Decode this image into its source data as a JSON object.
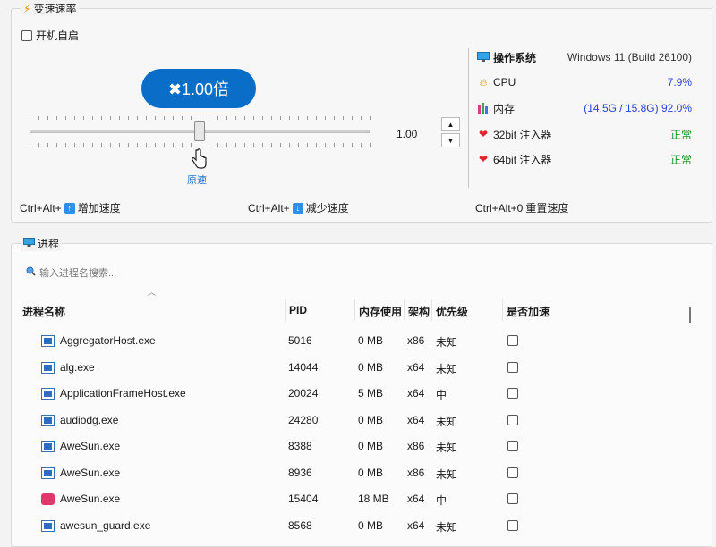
{
  "speed_group": {
    "title": "变速速率",
    "autostart_label": "开机自启",
    "multiplier_label": "✖1.00倍",
    "slider_value": 1.0,
    "speed_value": "1.00",
    "default_label": "原速",
    "spinner_up": "▲",
    "spinner_down": "▼"
  },
  "system_info": [
    {
      "icon": "monitor-icon",
      "label": "操作系统",
      "value": "Windows 11 (Build 26100)",
      "color": "gray"
    },
    {
      "icon": "flame-icon",
      "label": "CPU",
      "value": "7.9%",
      "color": "blue"
    },
    {
      "icon": "memory-icon",
      "label": "内存",
      "value": "(14.5G / 15.8G) 92.0%",
      "color": "blue"
    },
    {
      "icon": "heart-icon",
      "label": "32bit 注入器",
      "value": "正常",
      "color": "green"
    },
    {
      "icon": "heart-icon",
      "label": "64bit 注入器",
      "value": "正常",
      "color": "green"
    }
  ],
  "hotkeys": [
    {
      "prefix": "Ctrl+Alt+",
      "arrow": "↑",
      "label": "增加速度"
    },
    {
      "prefix": "Ctrl+Alt+",
      "arrow": "↓",
      "label": "减少速度"
    },
    {
      "prefix": "Ctrl+Alt+0",
      "arrow": "",
      "label": "重置速度"
    }
  ],
  "process_group": {
    "title": "进程",
    "search_placeholder": "输入进程名搜索...",
    "columns": [
      "进程名称",
      "PID",
      "内存使用",
      "架构",
      "优先级",
      "是否加速"
    ],
    "rows": [
      {
        "icon": "win",
        "name": "AggregatorHost.exe",
        "pid": "5016",
        "mem": "0 MB",
        "arch": "x86",
        "prio": "未知"
      },
      {
        "icon": "win",
        "name": "alg.exe",
        "pid": "14044",
        "mem": "0 MB",
        "arch": "x64",
        "prio": "未知"
      },
      {
        "icon": "win",
        "name": "ApplicationFrameHost.exe",
        "pid": "20024",
        "mem": "5 MB",
        "arch": "x64",
        "prio": "中"
      },
      {
        "icon": "win",
        "name": "audiodg.exe",
        "pid": "24280",
        "mem": "0 MB",
        "arch": "x64",
        "prio": "未知"
      },
      {
        "icon": "win",
        "name": "AweSun.exe",
        "pid": "8388",
        "mem": "0 MB",
        "arch": "x86",
        "prio": "未知"
      },
      {
        "icon": "win",
        "name": "AweSun.exe",
        "pid": "8936",
        "mem": "0 MB",
        "arch": "x86",
        "prio": "未知"
      },
      {
        "icon": "red",
        "name": "AweSun.exe",
        "pid": "15404",
        "mem": "18 MB",
        "arch": "x64",
        "prio": "中"
      },
      {
        "icon": "win",
        "name": "awesun_guard.exe",
        "pid": "8568",
        "mem": "0 MB",
        "arch": "x64",
        "prio": "未知"
      }
    ]
  },
  "colors": {
    "accent": "#0a6ec9",
    "green": "#1b8f2a",
    "blue": "#2a3fd6"
  }
}
